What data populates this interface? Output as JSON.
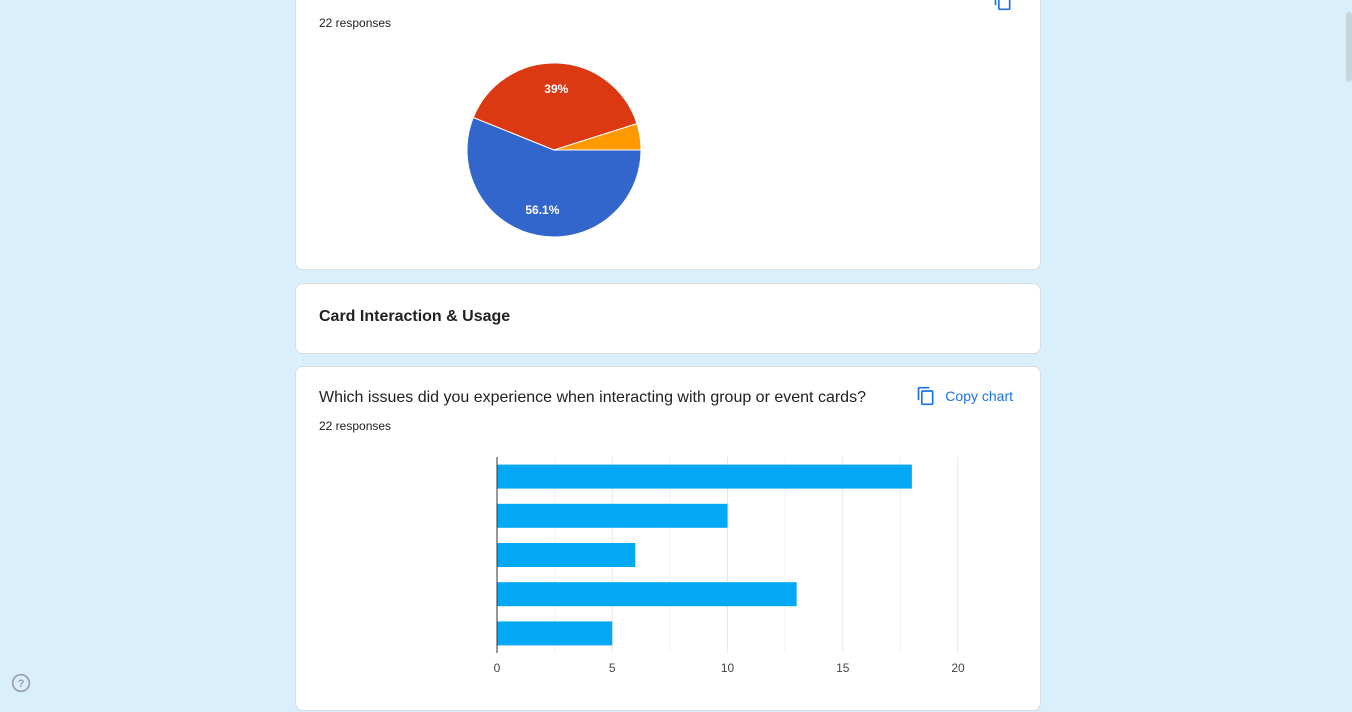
{
  "card1": {
    "responses": "22 responses",
    "chart_data": {
      "type": "pie",
      "slices": [
        {
          "value": 56.1,
          "label": "56.1%",
          "color": "#3366cc"
        },
        {
          "value": 39,
          "label": "39%",
          "color": "#dc3912"
        },
        {
          "value": 4.9,
          "label": "",
          "color": "#ff9900"
        }
      ]
    }
  },
  "section": {
    "title": "Card Interaction & Usage"
  },
  "card2": {
    "question": "Which issues did you experience when interacting with group or event cards?",
    "responses": "22 responses",
    "copy_label": "Copy chart",
    "copy_icon": "copy-icon",
    "chart_data": {
      "type": "bar",
      "orientation": "horizontal",
      "values": [
        18,
        10,
        6,
        13,
        5
      ],
      "xlim": [
        0,
        20
      ],
      "xticks": [
        "0",
        "5",
        "10",
        "15",
        "20"
      ],
      "bar_color": "#03a9f4",
      "grid": true
    }
  },
  "help_icon": "help-icon"
}
